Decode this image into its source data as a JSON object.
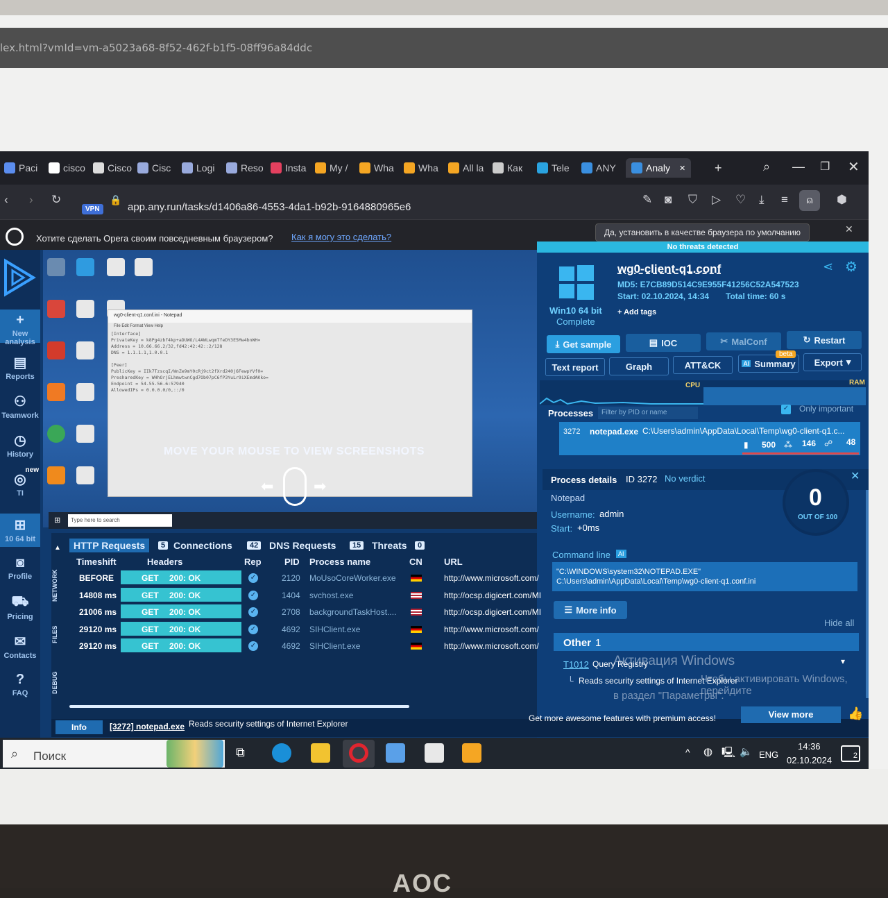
{
  "background_page": {
    "url_fragment": "lex.html?vmId=vm-a5023a68-8f52-462f-b1f5-08ff96a84ddc"
  },
  "browser": {
    "tabs": [
      {
        "label": "Paci",
        "icon": "page-icon",
        "color": "#5b8def"
      },
      {
        "label": "cisco",
        "icon": "google-icon",
        "color": "#ffffff"
      },
      {
        "label": "Cisco",
        "icon": "doc-icon",
        "color": "#dddddd"
      },
      {
        "label": "Cisc",
        "icon": "cisco-icon",
        "color": "#9ad"
      },
      {
        "label": "Logi",
        "icon": "cisco-icon",
        "color": "#9ad"
      },
      {
        "label": "Reso",
        "icon": "cisco-icon",
        "color": "#9ad"
      },
      {
        "label": "Insta",
        "icon": "instagram-icon",
        "color": "#e4405f"
      },
      {
        "label": "My /",
        "icon": "bolt-icon",
        "color": "#f5a623"
      },
      {
        "label": "Wha",
        "icon": "bolt-icon",
        "color": "#f5a623"
      },
      {
        "label": "Wha",
        "icon": "bolt-icon",
        "color": "#f5a623"
      },
      {
        "label": "All la",
        "icon": "bolt-icon",
        "color": "#f5a623"
      },
      {
        "label": "Как",
        "icon": "gear-icon",
        "color": "#cccccc"
      },
      {
        "label": "Tele",
        "icon": "telegram-icon",
        "color": "#2aa3e0"
      },
      {
        "label": "ANY",
        "icon": "anyrun-icon",
        "color": "#3a8fe0"
      },
      {
        "label": "Analy",
        "icon": "anyrun-icon",
        "color": "#3a8fe0",
        "active": true
      }
    ],
    "address": "app.any.run/tasks/d1406a86-4553-4da1-b92b-9164880965e6",
    "vpn_label": "VPN"
  },
  "opera_bar": {
    "question": "Хотите сделать Opera своим повседневным браузером?",
    "link": "Как я могу это сделать?",
    "button": "Да, установить в качестве браузера по умолчанию"
  },
  "left_nav": [
    {
      "label": "New analysis",
      "icon": "plus-icon"
    },
    {
      "label": "Reports",
      "icon": "reports-icon"
    },
    {
      "label": "Teamwork",
      "icon": "team-icon"
    },
    {
      "label": "History",
      "icon": "history-icon"
    },
    {
      "label": "TI",
      "icon": "ti-icon",
      "badge": "new"
    },
    {
      "label": "10 64 bit",
      "icon": "windows-icon"
    },
    {
      "label": "Profile",
      "icon": "profile-icon"
    },
    {
      "label": "Pricing",
      "icon": "cart-icon"
    },
    {
      "label": "Contacts",
      "icon": "mail-icon"
    },
    {
      "label": "FAQ",
      "icon": "faq-icon"
    }
  ],
  "vm_screen": {
    "notepad_title": "wg0-client-q1.conf.ini - Notepad",
    "notepad_menu": "File  Edit  Format  View  Help",
    "notepad_text": "[Interface]\nPrivateKey = k8Pg4zbf4kp+aDUWO/L4AWLwqmTfeDY3E5Mw4bnWH=\nAddress = 10.66.66.2/32,fd42:42:42::2/128\nDNS = 1.1.1.1,1.0.0.1\n\n[Peer]\nPublicKey = IIk7TzscqI/WnZe9mY0cRj9ct2fXrd240j6FewpYVf0=\nPresharedKey = WHhOrjELhmwtwnCgd7Ob07pC6fP3YuLr9iXEmdAKko=\nEndpoint = 54.55.56.6:57940\nAllowedIPs = 0.0.0.0/0,::/0",
    "overlay_hint": "MOVE YOUR MOUSE TO VIEW SCREENSHOTS",
    "search_placeholder": "Type here to search"
  },
  "network_tabs": [
    {
      "label": "HTTP Requests",
      "count": "5"
    },
    {
      "label": "Connections",
      "count": "42"
    },
    {
      "label": "DNS Requests",
      "count": "15"
    },
    {
      "label": "Threats",
      "count": "0"
    }
  ],
  "network_columns": {
    "timeshift": "Timeshift",
    "headers": "Headers",
    "rep": "Rep",
    "pid": "PID",
    "process": "Process name",
    "cn": "CN",
    "url": "URL"
  },
  "side_labels": {
    "network": "NETWORK",
    "files": "FILES",
    "debug": "DEBUG"
  },
  "http_rows": [
    {
      "time": "BEFORE",
      "method": "GET",
      "status": "200: OK",
      "pid": "2120",
      "process": "MoUsoCoreWorker.exe",
      "cn": "de",
      "url": "http://www.microsoft.com/"
    },
    {
      "time": "14808 ms",
      "method": "GET",
      "status": "200: OK",
      "pid": "1404",
      "process": "svchost.exe",
      "cn": "us",
      "url": "http://ocsp.digicert.com/MI"
    },
    {
      "time": "21006 ms",
      "method": "GET",
      "status": "200: OK",
      "pid": "2708",
      "process": "backgroundTaskHost....",
      "cn": "us",
      "url": "http://ocsp.digicert.com/MI"
    },
    {
      "time": "29120 ms",
      "method": "GET",
      "status": "200: OK",
      "pid": "4692",
      "process": "SIHClient.exe",
      "cn": "de",
      "url": "http://www.microsoft.com/"
    },
    {
      "time": "29120 ms",
      "method": "GET",
      "status": "200: OK",
      "pid": "4692",
      "process": "SIHClient.exe",
      "cn": "de",
      "url": "http://www.microsoft.com/"
    }
  ],
  "task": {
    "banner": "No threats detected",
    "filename": "wg0-client-q1.conf",
    "md5": "MD5: E7CB89D514C9E955F41256C52A547523",
    "start": "Start: 02.10.2024, 14:34",
    "total": "Total time: 60 s",
    "os": "Win10 64 bit",
    "os_status": "Complete",
    "add_tags": "Add tags"
  },
  "actions": {
    "get_sample": "Get sample",
    "ioc": "IOC",
    "malconf": "MalConf",
    "restart": "Restart",
    "text_report": "Text report",
    "graph": "Graph",
    "attck": "ATT&CK",
    "summary": "Summary",
    "summary_badge": "beta",
    "export": "Export"
  },
  "charts": {
    "cpu": "CPU",
    "ram": "RAM"
  },
  "processes": {
    "title": "Processes",
    "filter_placeholder": "Filter by PID or name",
    "only_important": "Only important",
    "row": {
      "pid": "3272",
      "name": "notepad.exe",
      "path": "C:\\Users\\admin\\AppData\\Local\\Temp\\wg0-client-q1.c...",
      "files": "500",
      "reg": "146",
      "net": "48"
    }
  },
  "details": {
    "title": "Process details",
    "id": "ID 3272",
    "verdict": "No verdict",
    "name": "Notepad",
    "username_label": "Username:",
    "username": "admin",
    "start_label": "Start:",
    "start": "+0ms",
    "score": "0",
    "score_of": "OUT OF 100",
    "cmd_label": "Command line",
    "cmd_line1": "\"C:\\WINDOWS\\system32\\NOTEPAD.EXE\"",
    "cmd_line2": "C:\\Users\\admin\\AppData\\Local\\Temp\\wg0-client-q1.conf.ini",
    "more_info": "More info",
    "hide_all": "Hide all",
    "other": "Other",
    "other_count": "1",
    "technique": "T1012",
    "technique_name": "Query Registry",
    "technique_desc": "Reads security settings of Internet Explorer"
  },
  "activation": {
    "line1": "Активация Windows",
    "line2": "Чтобы активировать Windows, перейдите",
    "line3": "в раздел \"Параметры\"."
  },
  "status": {
    "info": "Info",
    "proc": "[3272] notepad.exe",
    "message": "Reads security settings of Internet Explorer",
    "promo": "Get more awesome features with premium access!",
    "view_more": "View more"
  },
  "taskbar": {
    "search": "Поиск",
    "lang": "ENG",
    "time": "14:36",
    "date": "02.10.2024",
    "notif": "2"
  },
  "monitor_brand": "AOC"
}
